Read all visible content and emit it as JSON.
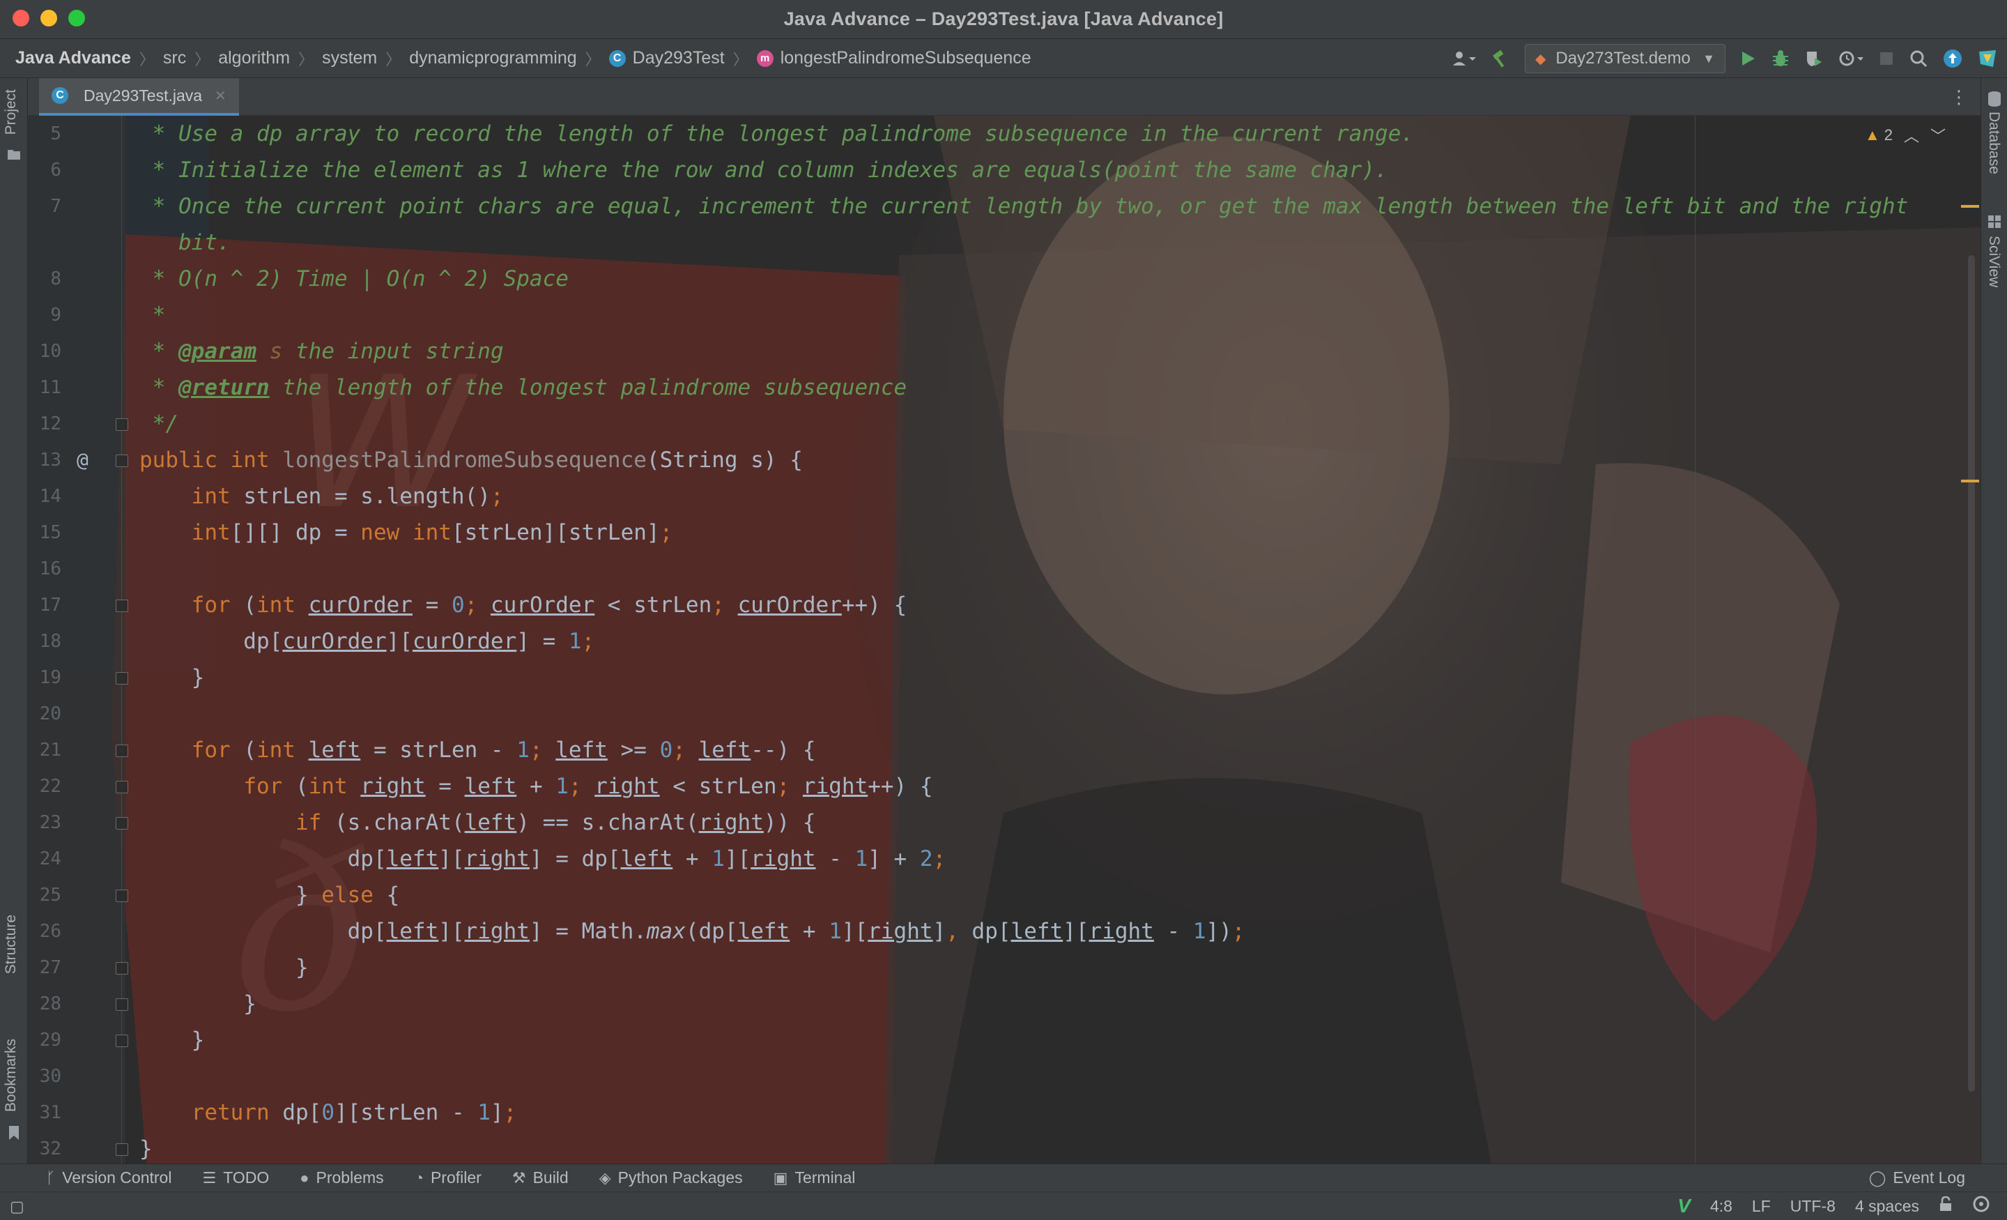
{
  "window": {
    "title": "Java Advance – Day293Test.java [Java Advance]"
  },
  "breadcrumbs": [
    "Java Advance",
    "src",
    "algorithm",
    "system",
    "dynamicprogramming",
    "Day293Test",
    "longestPalindromeSubsequence"
  ],
  "toolbar": {
    "run_config": "Day273Test.demo"
  },
  "left_tools": {
    "project": "Project",
    "structure": "Structure",
    "bookmarks": "Bookmarks"
  },
  "right_tools": {
    "database": "Database",
    "sciview": "SciView"
  },
  "tab": {
    "filename": "Day293Test.java"
  },
  "inspections": {
    "warning_count": "2"
  },
  "code_lines": [
    {
      "n": "5",
      "html": "<span class=\"cm\"> * Use a dp array to record the length of the longest palindrome subsequence in the current range.</span>"
    },
    {
      "n": "6",
      "html": "<span class=\"cm\"> * Initialize the element as 1 where the row and column indexes are equals(point the same char).</span>"
    },
    {
      "n": "7",
      "html": "<span class=\"cm\"> * Once the current point chars are equal, increment the current length by two, or get the max length between the left bit and the right</span>"
    },
    {
      "n": "",
      "html": "<span class=\"cm\">   bit.</span>"
    },
    {
      "n": "8",
      "html": "<span class=\"cm\"> * O(n ^ 2) Time | O(n ^ 2) Space</span>"
    },
    {
      "n": "9",
      "html": "<span class=\"cm\"> *</span>"
    },
    {
      "n": "10",
      "html": "<span class=\"cm\"> * </span><span class=\"tag\">@param</span><span class=\"cm\"> </span><span class=\"pn\">s</span><span class=\"cm\"> the input string</span>"
    },
    {
      "n": "11",
      "html": "<span class=\"cm\"> * </span><span class=\"tag\">@return</span><span class=\"cm\"> the length of the longest palindrome subsequence</span>"
    },
    {
      "n": "12",
      "html": "<span class=\"cm\"> */</span>",
      "fold": true
    },
    {
      "n": "13",
      "html": "<span class=\"kw\">public int </span><span class=\"fnu\">longestPalindromeSubsequence</span>(String s) {",
      "fold": true,
      "mark": "@"
    },
    {
      "n": "14",
      "html": "    <span class=\"kw\">int </span>strLen = s.length()<span class=\"kw\">;</span>"
    },
    {
      "n": "15",
      "html": "    <span class=\"kw\">int</span>[][] dp = <span class=\"kw\">new int</span>[strLen][strLen]<span class=\"kw\">;</span>"
    },
    {
      "n": "16",
      "html": ""
    },
    {
      "n": "17",
      "html": "    <span class=\"kw\">for </span>(<span class=\"kw\">int </span><span class=\"var\">curOrder</span> = <span class=\"num\">0</span><span class=\"kw\">; </span><span class=\"var\">curOrder</span> &lt; strLen<span class=\"kw\">; </span><span class=\"var\">curOrder</span>++) {",
      "fold": true
    },
    {
      "n": "18",
      "html": "        dp[<span class=\"var\">curOrder</span>][<span class=\"var\">curOrder</span>] = <span class=\"num\">1</span><span class=\"kw\">;</span>"
    },
    {
      "n": "19",
      "html": "    }",
      "fold": true
    },
    {
      "n": "20",
      "html": ""
    },
    {
      "n": "21",
      "html": "    <span class=\"kw\">for </span>(<span class=\"kw\">int </span><span class=\"var\">left</span> = strLen - <span class=\"num\">1</span><span class=\"kw\">; </span><span class=\"var\">left</span> &gt;= <span class=\"num\">0</span><span class=\"kw\">; </span><span class=\"var\">left</span>--) {",
      "fold": true
    },
    {
      "n": "22",
      "html": "        <span class=\"kw\">for </span>(<span class=\"kw\">int </span><span class=\"var\">right</span> = <span class=\"var\">left</span> + <span class=\"num\">1</span><span class=\"kw\">; </span><span class=\"var\">right</span> &lt; strLen<span class=\"kw\">; </span><span class=\"var\">right</span>++) {",
      "fold": true
    },
    {
      "n": "23",
      "html": "            <span class=\"kw\">if </span>(s.charAt(<span class=\"var\">left</span>) == s.charAt(<span class=\"var\">right</span>)) {",
      "fold": true
    },
    {
      "n": "24",
      "html": "                dp[<span class=\"var\">left</span>][<span class=\"var\">right</span>] = dp[<span class=\"var\">left</span> + <span class=\"num\">1</span>][<span class=\"var\">right</span> - <span class=\"num\">1</span>] + <span class=\"num\">2</span><span class=\"kw\">;</span>"
    },
    {
      "n": "25",
      "html": "            } <span class=\"kw\">else </span>{",
      "fold": true
    },
    {
      "n": "26",
      "html": "                dp[<span class=\"var\">left</span>][<span class=\"var\">right</span>] = Math.<span class=\"st\">max</span>(dp[<span class=\"var\">left</span> + <span class=\"num\">1</span>][<span class=\"var\">right</span>]<span class=\"kw\">, </span>dp[<span class=\"var\">left</span>][<span class=\"var\">right</span> - <span class=\"num\">1</span>])<span class=\"kw\">;</span>"
    },
    {
      "n": "27",
      "html": "            }",
      "fold": true
    },
    {
      "n": "28",
      "html": "        }",
      "fold": true
    },
    {
      "n": "29",
      "html": "    }",
      "fold": true
    },
    {
      "n": "30",
      "html": ""
    },
    {
      "n": "31",
      "html": "    <span class=\"kw\">return </span>dp[<span class=\"num\">0</span>][strLen - <span class=\"num\">1</span>]<span class=\"kw\">;</span>"
    },
    {
      "n": "32",
      "html": "}",
      "fold": true
    }
  ],
  "bottom_tools": [
    "Version Control",
    "TODO",
    "Problems",
    "Profiler",
    "Build",
    "Python Packages",
    "Terminal"
  ],
  "event_log": "Event Log",
  "status": {
    "position": "4:8",
    "line_sep": "LF",
    "encoding": "UTF-8",
    "indent": "4 spaces"
  },
  "colors": {
    "keyword": "#cc7832",
    "comment": "#629755",
    "number": "#6897bb",
    "text": "#a9b7c6",
    "accent": "#4a88c7"
  }
}
